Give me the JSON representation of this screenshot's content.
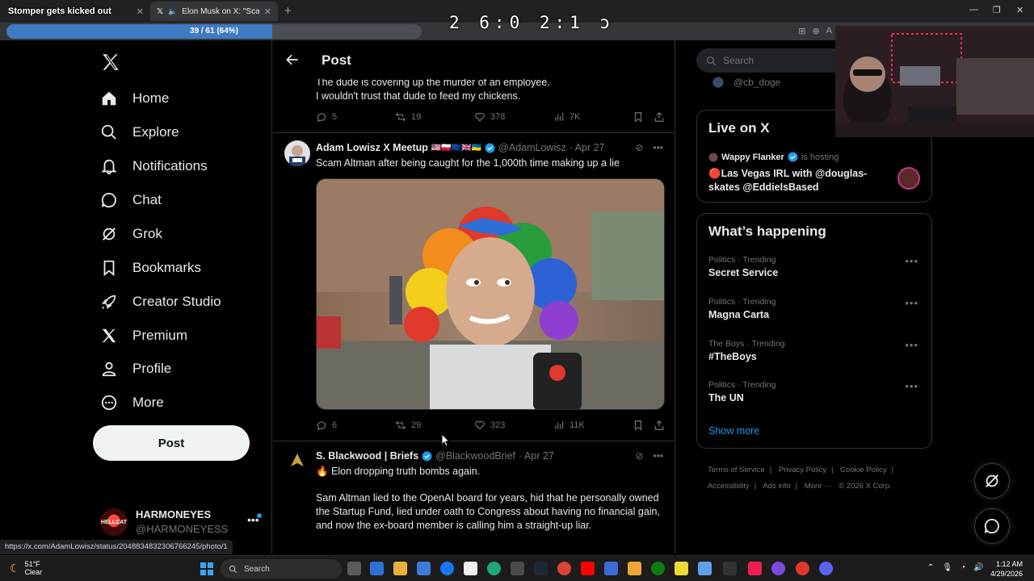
{
  "browser": {
    "tabs": [
      {
        "title": "Stomper gets kicked out"
      },
      {
        "title": "Elon Musk on X: \"Scam Altma"
      }
    ],
    "progress": {
      "label": "39 / 61 (64%)",
      "percent": 64
    },
    "timer": "2 6:0 2:1 ɔ"
  },
  "nav": {
    "items": [
      {
        "label": "Home",
        "icon": "home-icon"
      },
      {
        "label": "Explore",
        "icon": "search-icon"
      },
      {
        "label": "Notifications",
        "icon": "bell-icon"
      },
      {
        "label": "Chat",
        "icon": "chat-icon"
      },
      {
        "label": "Grok",
        "icon": "grok-icon"
      },
      {
        "label": "Bookmarks",
        "icon": "bookmark-icon"
      },
      {
        "label": "Creator Studio",
        "icon": "rocket-icon"
      },
      {
        "label": "Premium",
        "icon": "x-icon"
      },
      {
        "label": "Profile",
        "icon": "person-icon"
      },
      {
        "label": "More",
        "icon": "more-circle-icon"
      }
    ],
    "post_label": "Post",
    "account": {
      "name": "HARMONEYES",
      "handle": "@HARMONEYESS",
      "avatar_text": "HELLCAT"
    }
  },
  "main": {
    "title": "Post",
    "prev_tweet": {
      "lines": [
        "The dude is covering up the murder of an employee.",
        "I wouldn't trust that dude to feed my chickens."
      ],
      "replies": "5",
      "reposts": "19",
      "likes": "378",
      "views": "7K"
    },
    "tweet1": {
      "name": "Adam Lowisz X Meetup",
      "flags": "🇺🇸🇵🇱🇪🇺🇬🇧🇺🇦",
      "handle": "@AdamLowisz",
      "date": "· Apr 27",
      "text": "Scam Altman after being caught for the 1,000th time making up a lie",
      "replies": "6",
      "reposts": "29",
      "likes": "323",
      "views": "11K"
    },
    "tweet2": {
      "name": "S. Blackwood | Briefs",
      "handle": "@BlackwoodBrief",
      "date": "· Apr 27",
      "line1": "🔥 Elon dropping truth bombs again.",
      "body": "Sam Altman lied to the OpenAI board for years, hid that he personally owned the Startup Fund, lied under oath to Congress about having no financial gain, and now the ex-board member is calling him a straight-up liar."
    }
  },
  "right": {
    "search_placeholder": "Search",
    "cb_handle": "@cb_doge",
    "live": {
      "title": "Live on X",
      "host_name": "Wappy Flanker",
      "host_text": "is hosting",
      "stream_title": "🔴Las Vegas IRL with @douglas-skates @EddieIsBased"
    },
    "happening": {
      "title": "What’s happening",
      "trends": [
        {
          "meta": "Politics · Trending",
          "topic": "Secret Service"
        },
        {
          "meta": "Politics · Trending",
          "topic": "Magna Carta"
        },
        {
          "meta": "The Boys · Trending",
          "topic": "#TheBoys"
        },
        {
          "meta": "Politics · Trending",
          "topic": "The UN"
        }
      ],
      "show_more": "Show more"
    },
    "footer": [
      "Terms of Service",
      "|",
      "Privacy Policy",
      "|",
      "Cookie Policy",
      "|",
      "Accessibility",
      "|",
      "Ads info",
      "|",
      "More ···",
      "© 2026 X Corp."
    ]
  },
  "status_url": "https://x.com/AdamLowisz/status/2048834832306766245/photo/1",
  "taskbar": {
    "weather_temp": "51°F",
    "weather_desc": "Clear",
    "search_label": "Search",
    "time": "1:12 AM",
    "date": "4/29/2026"
  }
}
